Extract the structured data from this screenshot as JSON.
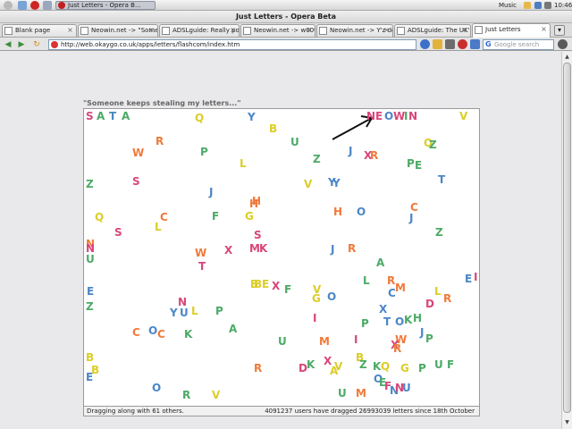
{
  "taskbar": {
    "task_title": "Just Letters - Opera B...",
    "music_label": "Music",
    "clock": "10:46"
  },
  "window": {
    "title": "Just Letters - Opera Beta"
  },
  "tabs": [
    {
      "label": "Blank page"
    },
    {
      "label": "Neowin.net -> \"Someon..."
    },
    {
      "label": "ADSLguide: Really poor ..."
    },
    {
      "label": "Neowin.net -> w00t I'm ..."
    },
    {
      "label": "Neowin.net -> Y'z dock ..."
    },
    {
      "label": "ADSLguide: The UK's lar..."
    },
    {
      "label": "Just Letters"
    }
  ],
  "address": {
    "url": "http://web.okaygo.co.uk/apps/letters/flashcom/index.htm",
    "search_placeholder": "Google search"
  },
  "page": {
    "heading": "\"Someone keeps stealing my letters...\"",
    "status_left": "Dragging along with 61 others.",
    "status_right": "4091237 users have dragged 26993039 letters since 18th October"
  },
  "colors": {
    "red": "#d9483b",
    "orange": "#f07a3a",
    "yellow": "#dccd28",
    "green": "#4caa66",
    "blue": "#4c86c6",
    "pink": "#d8467a",
    "purple": "#c24d6e",
    "darkred": "#b53a3a"
  },
  "letters": [
    {
      "ch": "S",
      "c": "#d8467a"
    },
    {
      "ch": "A",
      "c": "#4caa66"
    },
    {
      "ch": "T",
      "c": "#4c86c6"
    },
    {
      "ch": "A",
      "c": "#4caa66"
    },
    {
      "ch": "Q",
      "c": "#dccd28"
    },
    {
      "ch": "Y",
      "c": "#4c86c6"
    },
    {
      "ch": "B",
      "c": "#dccd28"
    },
    {
      "ch": "U",
      "c": "#4caa66"
    },
    {
      "ch": "N",
      "c": "#d8467a"
    },
    {
      "ch": "E",
      "c": "#d8467a"
    },
    {
      "ch": "O",
      "c": "#4c86c6"
    },
    {
      "ch": "W",
      "c": "#d8467a"
    },
    {
      "ch": "I",
      "c": "#4caa66"
    },
    {
      "ch": "N",
      "c": "#d8467a"
    },
    {
      "ch": "V",
      "c": "#dccd28"
    },
    {
      "ch": "R",
      "c": "#f07a3a"
    },
    {
      "ch": "W",
      "c": "#f07a3a"
    },
    {
      "ch": "P",
      "c": "#4caa66"
    },
    {
      "ch": "L",
      "c": "#dccd28"
    },
    {
      "ch": "Z",
      "c": "#4caa66"
    },
    {
      "ch": "J",
      "c": "#4c86c6"
    },
    {
      "ch": "X",
      "c": "#d8467a"
    },
    {
      "ch": "R",
      "c": "#f07a3a"
    },
    {
      "ch": "Q",
      "c": "#dccd28"
    },
    {
      "ch": "Z",
      "c": "#4caa66"
    },
    {
      "ch": "Z",
      "c": "#4caa66"
    },
    {
      "ch": "S",
      "c": "#d8467a"
    },
    {
      "ch": "V",
      "c": "#dccd28"
    },
    {
      "ch": "Y",
      "c": "#4c86c6"
    },
    {
      "ch": "Y",
      "c": "#4c86c6"
    },
    {
      "ch": "P",
      "c": "#4caa66"
    },
    {
      "ch": "E",
      "c": "#4caa66"
    },
    {
      "ch": "T",
      "c": "#4c86c6"
    },
    {
      "ch": "J",
      "c": "#4c86c6"
    },
    {
      "ch": "H",
      "c": "#f07a3a"
    },
    {
      "ch": "H",
      "c": "#f07a3a"
    },
    {
      "ch": "Q",
      "c": "#dccd28"
    },
    {
      "ch": "C",
      "c": "#f07a3a"
    },
    {
      "ch": "F",
      "c": "#4caa66"
    },
    {
      "ch": "G",
      "c": "#dccd28"
    },
    {
      "ch": "H",
      "c": "#f07a3a"
    },
    {
      "ch": "O",
      "c": "#4c86c6"
    },
    {
      "ch": "C",
      "c": "#f07a3a"
    },
    {
      "ch": "J",
      "c": "#4c86c6"
    },
    {
      "ch": "S",
      "c": "#d8467a"
    },
    {
      "ch": "L",
      "c": "#dccd28"
    },
    {
      "ch": "S",
      "c": "#d8467a"
    },
    {
      "ch": "Z",
      "c": "#4caa66"
    },
    {
      "ch": "N",
      "c": "#f07a3a"
    },
    {
      "ch": "U",
      "c": "#4caa66"
    },
    {
      "ch": "W",
      "c": "#f07a3a"
    },
    {
      "ch": "T",
      "c": "#d8467a"
    },
    {
      "ch": "X",
      "c": "#d8467a"
    },
    {
      "ch": "M",
      "c": "#d8467a"
    },
    {
      "ch": "K",
      "c": "#d8467a"
    },
    {
      "ch": "J",
      "c": "#4c86c6"
    },
    {
      "ch": "R",
      "c": "#f07a3a"
    },
    {
      "ch": "N",
      "c": "#d8467a"
    },
    {
      "ch": "A",
      "c": "#4caa66"
    },
    {
      "ch": "L",
      "c": "#4caa66"
    },
    {
      "ch": "R",
      "c": "#f07a3a"
    },
    {
      "ch": "M",
      "c": "#f07a3a"
    },
    {
      "ch": "B",
      "c": "#dccd28"
    },
    {
      "ch": "L",
      "c": "#dccd28"
    },
    {
      "ch": "E",
      "c": "#4c86c6"
    },
    {
      "ch": "I",
      "c": "#d8467a"
    },
    {
      "ch": "E",
      "c": "#4c86c6"
    },
    {
      "ch": "B",
      "c": "#dccd28"
    },
    {
      "ch": "E",
      "c": "#dccd28"
    },
    {
      "ch": "X",
      "c": "#d8467a"
    },
    {
      "ch": "F",
      "c": "#4caa66"
    },
    {
      "ch": "V",
      "c": "#dccd28"
    },
    {
      "ch": "G",
      "c": "#dccd28"
    },
    {
      "ch": "O",
      "c": "#4c86c6"
    },
    {
      "ch": "Z",
      "c": "#4caa66"
    },
    {
      "ch": "N",
      "c": "#d8467a"
    },
    {
      "ch": "Y",
      "c": "#4c86c6"
    },
    {
      "ch": "U",
      "c": "#4c86c6"
    },
    {
      "ch": "L",
      "c": "#dccd28"
    },
    {
      "ch": "P",
      "c": "#4caa66"
    },
    {
      "ch": "C",
      "c": "#4c86c6"
    },
    {
      "ch": "D",
      "c": "#d8467a"
    },
    {
      "ch": "R",
      "c": "#f07a3a"
    },
    {
      "ch": "X",
      "c": "#4c86c6"
    },
    {
      "ch": "I",
      "c": "#d8467a"
    },
    {
      "ch": "P",
      "c": "#4caa66"
    },
    {
      "ch": "T",
      "c": "#4c86c6"
    },
    {
      "ch": "O",
      "c": "#4c86c6"
    },
    {
      "ch": "K",
      "c": "#4caa66"
    },
    {
      "ch": "H",
      "c": "#4caa66"
    },
    {
      "ch": "C",
      "c": "#f07a3a"
    },
    {
      "ch": "O",
      "c": "#4c86c6"
    },
    {
      "ch": "C",
      "c": "#f07a3a"
    },
    {
      "ch": "K",
      "c": "#4caa66"
    },
    {
      "ch": "A",
      "c": "#4caa66"
    },
    {
      "ch": "J",
      "c": "#4c86c6"
    },
    {
      "ch": "P",
      "c": "#4caa66"
    },
    {
      "ch": "W",
      "c": "#f07a3a"
    },
    {
      "ch": "B",
      "c": "#dccd28"
    },
    {
      "ch": "U",
      "c": "#4caa66"
    },
    {
      "ch": "M",
      "c": "#f07a3a"
    },
    {
      "ch": "I",
      "c": "#d8467a"
    },
    {
      "ch": "X",
      "c": "#d8467a"
    },
    {
      "ch": "R",
      "c": "#f07a3a"
    },
    {
      "ch": "B",
      "c": "#dccd28"
    },
    {
      "ch": "X",
      "c": "#d8467a"
    },
    {
      "ch": "R",
      "c": "#f07a3a"
    },
    {
      "ch": "D",
      "c": "#d8467a"
    },
    {
      "ch": "K",
      "c": "#4caa66"
    },
    {
      "ch": "A",
      "c": "#dccd28"
    },
    {
      "ch": "V",
      "c": "#dccd28"
    },
    {
      "ch": "Z",
      "c": "#4caa66"
    },
    {
      "ch": "K",
      "c": "#4caa66"
    },
    {
      "ch": "Q",
      "c": "#dccd28"
    },
    {
      "ch": "G",
      "c": "#dccd28"
    },
    {
      "ch": "P",
      "c": "#4caa66"
    },
    {
      "ch": "U",
      "c": "#4caa66"
    },
    {
      "ch": "F",
      "c": "#4caa66"
    },
    {
      "ch": "B",
      "c": "#dccd28"
    },
    {
      "ch": "E",
      "c": "#4c86c6"
    },
    {
      "ch": "O",
      "c": "#4c86c6"
    },
    {
      "ch": "R",
      "c": "#4caa66"
    },
    {
      "ch": "V",
      "c": "#dccd28"
    },
    {
      "ch": "U",
      "c": "#4caa66"
    },
    {
      "ch": "M",
      "c": "#f07a3a"
    },
    {
      "ch": "O",
      "c": "#4c86c6"
    },
    {
      "ch": "E",
      "c": "#4caa66"
    },
    {
      "ch": "F",
      "c": "#d8467a"
    },
    {
      "ch": "N",
      "c": "#4c86c6"
    },
    {
      "ch": "N",
      "c": "#d8467a"
    },
    {
      "ch": "U",
      "c": "#4c86c6"
    }
  ]
}
